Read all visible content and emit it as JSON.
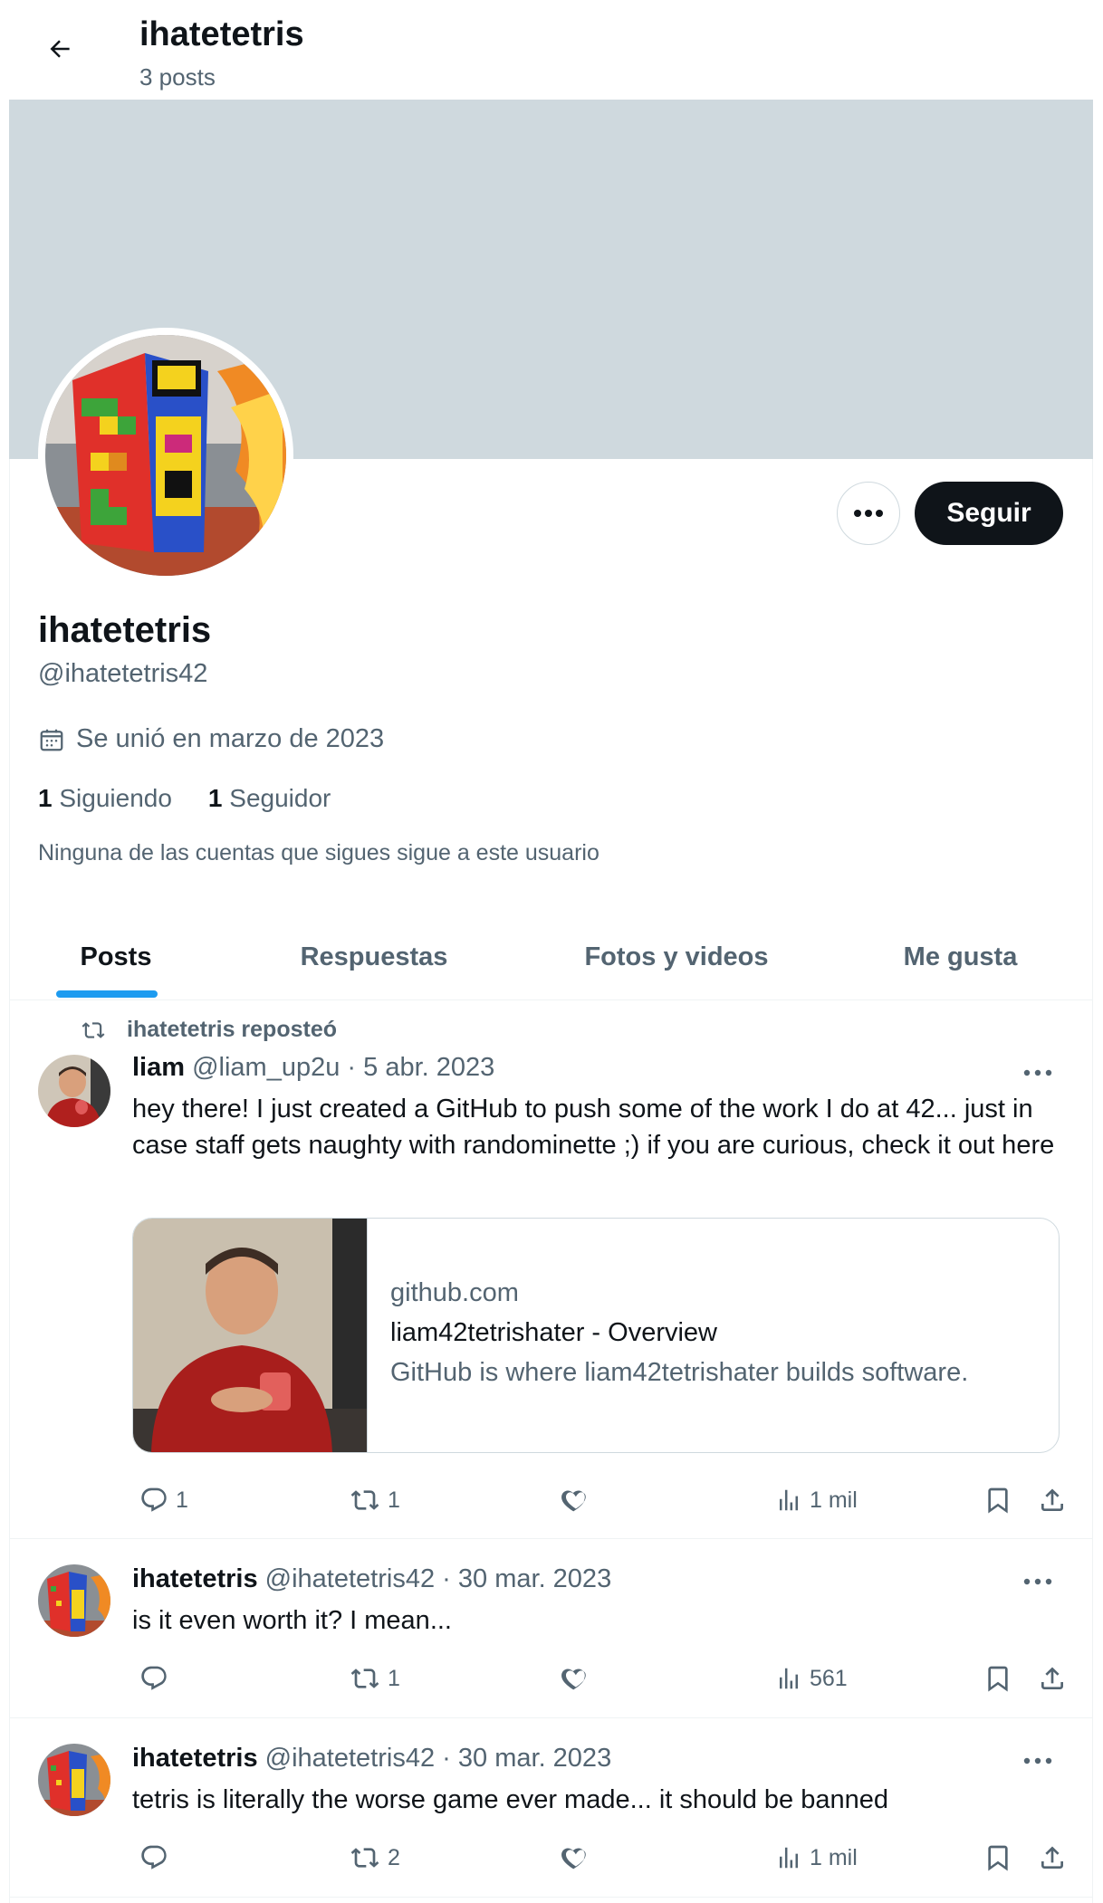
{
  "header": {
    "title": "ihatetetris",
    "post_count": "3 posts"
  },
  "profile": {
    "name": "ihatetetris",
    "handle": "@ihatetetris42",
    "joined": "Se unió en marzo de 2023",
    "following_count": "1",
    "following_label": "Siguiendo",
    "followers_count": "1",
    "followers_label": "Seguidor",
    "mutual_note": "Ninguna de las cuentas que sigues sigue a este usuario",
    "follow_button": "Seguir"
  },
  "tabs": [
    {
      "label": "Posts",
      "active": true
    },
    {
      "label": "Respuestas",
      "active": false
    },
    {
      "label": "Fotos y videos",
      "active": false
    },
    {
      "label": "Me gusta",
      "active": false
    }
  ],
  "posts": [
    {
      "repost_label": "ihatetetris reposteó",
      "author": "liam",
      "handle": "@liam_up2u",
      "date": "5 abr. 2023",
      "text": "hey there! I just created a GitHub to push some of the work I do at 42... just in case staff gets naughty with randominette ;) if you are curious, check it out here",
      "card": {
        "domain": "github.com",
        "title": "liam42tetrishater - Overview",
        "description": "GitHub is where liam42tetrishater builds software."
      },
      "replies": "1",
      "reposts": "1",
      "likes": "",
      "views": "1 mil"
    },
    {
      "author": "ihatetetris",
      "handle": "@ihatetetris42",
      "date": "30 mar. 2023",
      "text": "is it even worth it? I mean...",
      "replies": "",
      "reposts": "1",
      "likes": "",
      "views": "561"
    },
    {
      "author": "ihatetetris",
      "handle": "@ihatetetris42",
      "date": "30 mar. 2023",
      "text": "tetris is literally the worse game ever made... it should be banned",
      "replies": "",
      "reposts": "2",
      "likes": "",
      "views": "1 mil"
    }
  ],
  "colors": {
    "accent": "#1d9bf0",
    "banner": "#cfd9de",
    "text": "#0f1419",
    "muted": "#536471"
  }
}
